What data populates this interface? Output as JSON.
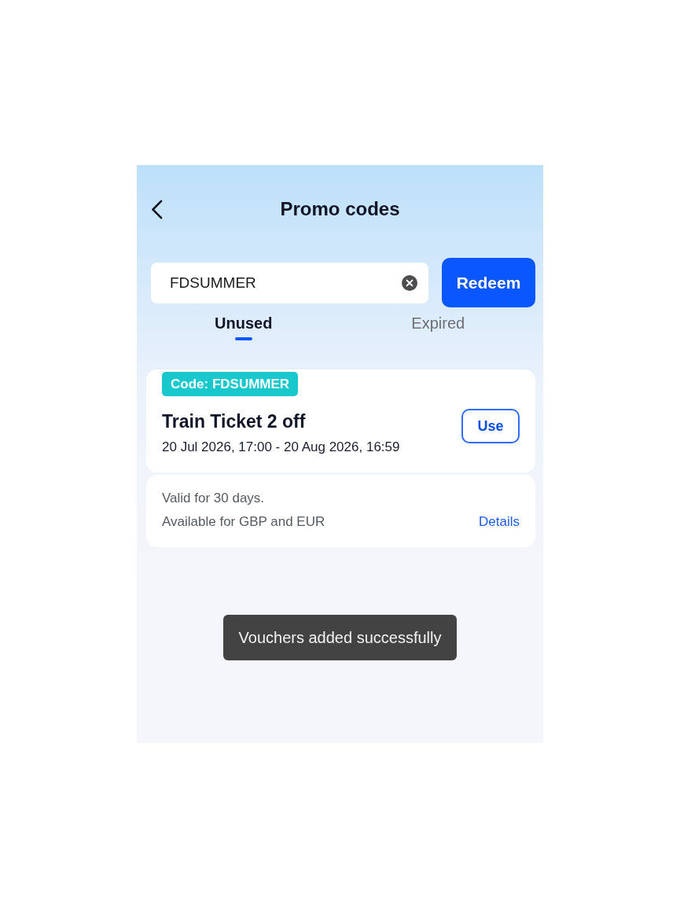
{
  "header": {
    "title": "Promo codes"
  },
  "search": {
    "value": "FDSUMMER",
    "button": "Redeem"
  },
  "tabs": [
    {
      "label": "Unused",
      "selected": true
    },
    {
      "label": "Expired",
      "selected": false
    }
  ],
  "vouchers": [
    {
      "code": "Code: FDSUMMER",
      "title": "Train Ticket 2 off",
      "validity": "20 Jul 2026, 17:00 - 20 Aug 2026, 16:59",
      "action": "Use",
      "notes": [
        "Valid for 30 days.",
        "Available for GBP and EUR"
      ],
      "details_link": "Details"
    }
  ],
  "toast": "Vouchers added successfully"
}
